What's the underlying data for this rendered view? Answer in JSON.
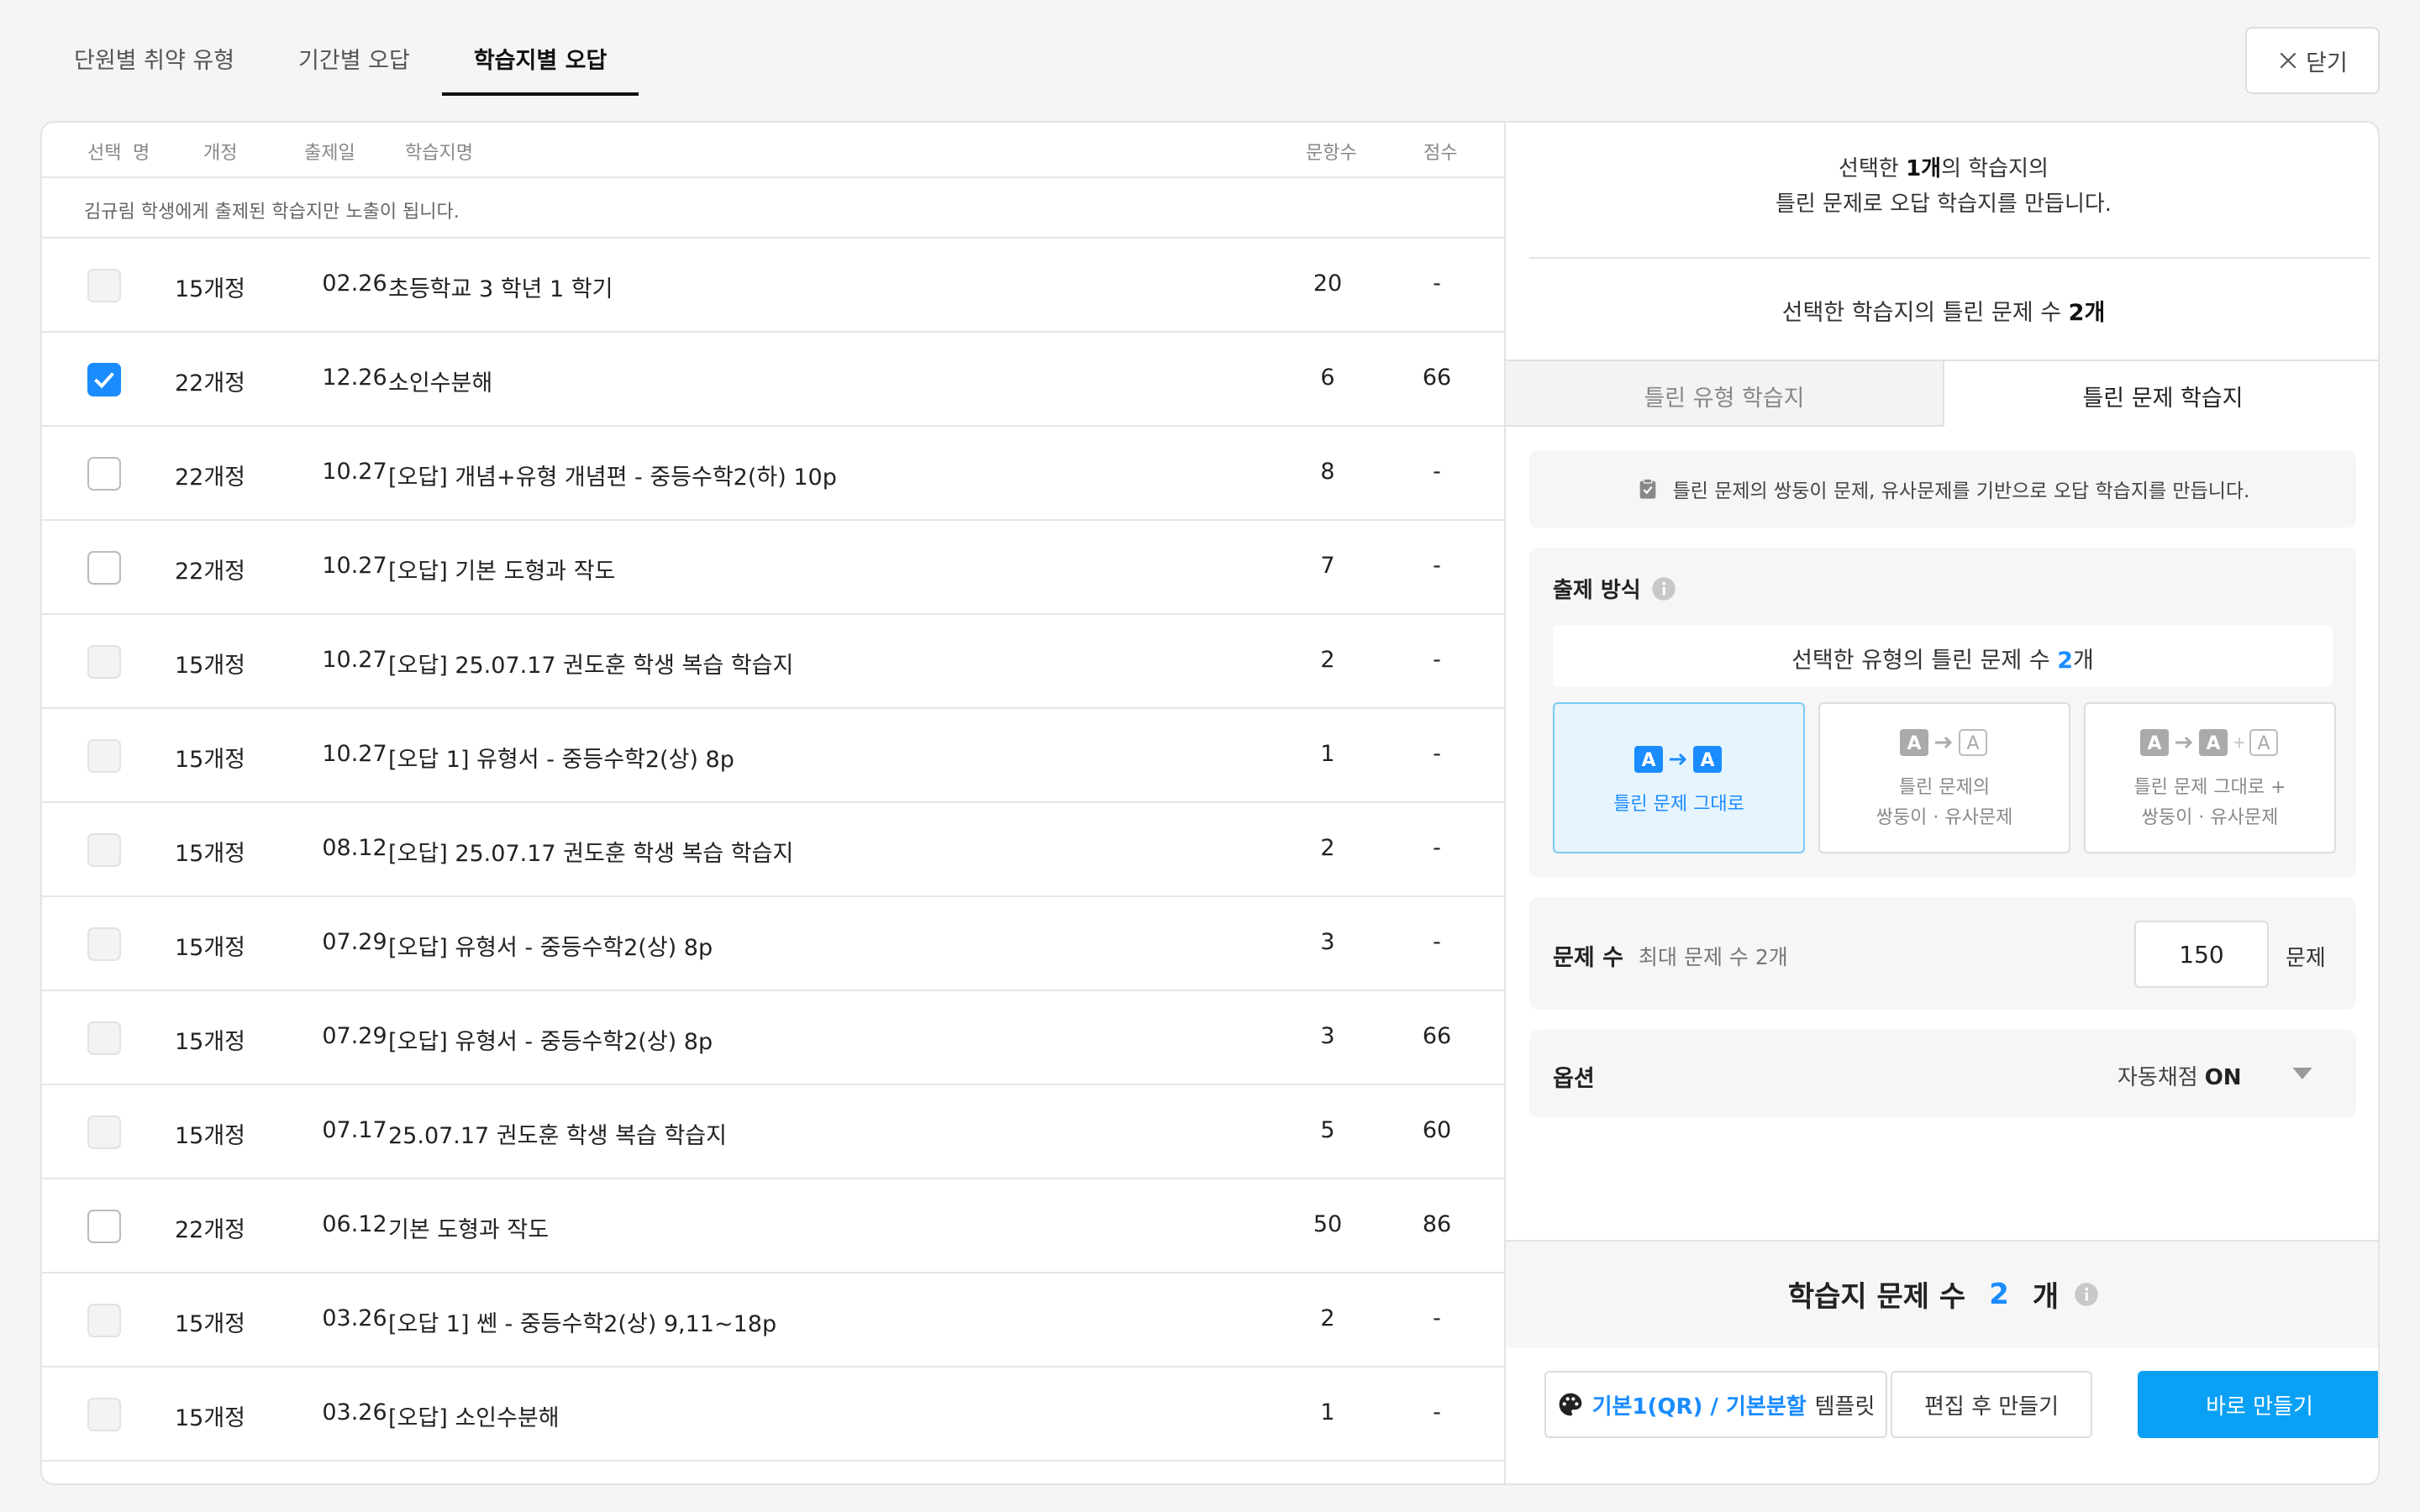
{
  "tabs": [
    "단원별 취약 유형",
    "기간별 오답",
    "학습지별 오답"
  ],
  "close_label": "닫기",
  "table": {
    "headers": {
      "select": "선택",
      "name": "명",
      "revision": "개정",
      "date": "출제일",
      "title": "학습지명",
      "count": "문항수",
      "score": "점수"
    },
    "notice": "김규림 학생에게 출제된 학습지만 노출이 됩니다.",
    "rows": [
      {
        "revision": "15개정",
        "date": "02.26",
        "title": "초등학교 3 학년 1 학기",
        "count": "20",
        "score": "-",
        "state": "disabled"
      },
      {
        "revision": "22개정",
        "date": "12.26",
        "title": "소인수분해",
        "count": "6",
        "score": "66",
        "state": "checked"
      },
      {
        "revision": "22개정",
        "date": "10.27",
        "title": "[오답] 개념+유형 개념편 - 중등수학2(하) 10p",
        "count": "8",
        "score": "-",
        "state": "unchecked"
      },
      {
        "revision": "22개정",
        "date": "10.27",
        "title": "[오답] 기본 도형과 작도",
        "count": "7",
        "score": "-",
        "state": "unchecked"
      },
      {
        "revision": "15개정",
        "date": "10.27",
        "title": "[오답] 25.07.17 권도훈 학생 복습 학습지",
        "count": "2",
        "score": "-",
        "state": "disabled"
      },
      {
        "revision": "15개정",
        "date": "10.27",
        "title": "[오답 1] 유형서 - 중등수학2(상) 8p",
        "count": "1",
        "score": "-",
        "state": "disabled"
      },
      {
        "revision": "15개정",
        "date": "08.12",
        "title": "[오답] 25.07.17 권도훈 학생 복습 학습지",
        "count": "2",
        "score": "-",
        "state": "disabled"
      },
      {
        "revision": "15개정",
        "date": "07.29",
        "title": "[오답] 유형서 - 중등수학2(상) 8p",
        "count": "3",
        "score": "-",
        "state": "disabled"
      },
      {
        "revision": "15개정",
        "date": "07.29",
        "title": "[오답] 유형서 - 중등수학2(상) 8p",
        "count": "3",
        "score": "66",
        "state": "disabled"
      },
      {
        "revision": "15개정",
        "date": "07.17",
        "title": "25.07.17 권도훈 학생 복습 학습지",
        "count": "5",
        "score": "60",
        "state": "disabled"
      },
      {
        "revision": "22개정",
        "date": "06.12",
        "title": "기본 도형과 작도",
        "count": "50",
        "score": "86",
        "state": "unchecked"
      },
      {
        "revision": "15개정",
        "date": "03.26",
        "title": "[오답 1] 쎈 - 중등수학2(상) 9,11~18p",
        "count": "2",
        "score": "-",
        "state": "disabled"
      },
      {
        "revision": "15개정",
        "date": "03.26",
        "title": "[오답] 소인수분해",
        "count": "1",
        "score": "-",
        "state": "disabled"
      }
    ]
  },
  "right": {
    "desc": {
      "l1_pre": "선택한 ",
      "l1_bold": "1개",
      "l1_post": "의 학습지의",
      "l2": "틀린 문제로 오답 학습지를 만듭니다."
    },
    "wrong_count": {
      "pre": "선택한 학습지의 틀린 문제 수 ",
      "bold": "2개"
    },
    "sub_tabs": [
      "틀린 유형 학습지",
      "틀린 문제 학습지"
    ],
    "info": "틀린 문제의 쌍둥이 문제, 유사문제를 기반으로 오답 학습지를 만듭니다.",
    "method": {
      "title": "출제 방식",
      "count_pre": "선택한 유형의 틀린 문제 수 ",
      "count_n": "2",
      "count_post": "개",
      "options": [
        {
          "l1": "틀린 문제 그대로",
          "l2": ""
        },
        {
          "l1": "틀린 문제의",
          "l2": "쌍둥이 · 유사문제"
        },
        {
          "l1": "틀린 문제 그대로 +",
          "l2": "쌍둥이 · 유사문제"
        }
      ]
    },
    "qcount": {
      "label": "문제 수",
      "max": "최대 문제 수 2개",
      "value": "150",
      "unit": "문제"
    },
    "option": {
      "label": "옵션",
      "value_label": "자동채점",
      "value": "ON"
    },
    "total": {
      "label": "학습지 문제 수",
      "n": "2",
      "unit": "개"
    },
    "buttons": {
      "template_blue": "기본1(QR) / 기본분할",
      "template_suffix": "템플릿",
      "edit": "편집 후 만들기",
      "make": "바로 만들기"
    }
  },
  "colors": {
    "accent": "#1a8cff",
    "primary_button": "#0aa0f5"
  }
}
